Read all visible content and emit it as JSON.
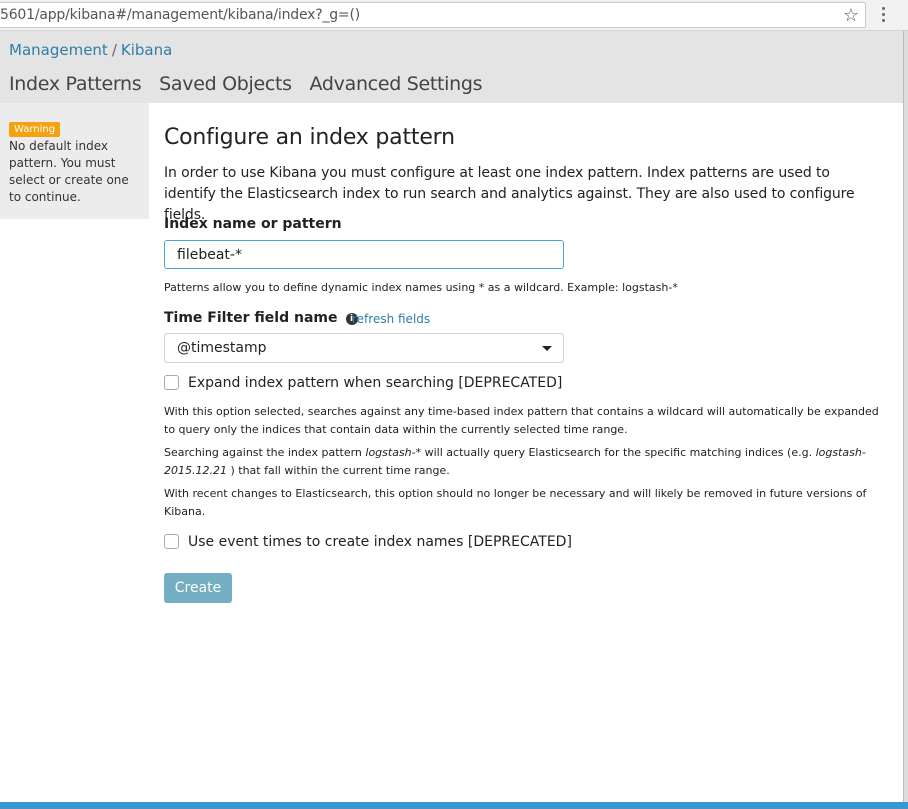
{
  "browser": {
    "url": "5601/app/kibana#/management/kibana/index?_g=()",
    "star_icon": "star-icon",
    "menu_icon": "more-vert-icon"
  },
  "breadcrumb": {
    "management": "Management",
    "separator": "/",
    "kibana": "Kibana"
  },
  "nav": {
    "tabs": [
      "Index Patterns",
      "Saved Objects",
      "Advanced Settings"
    ]
  },
  "sidebar": {
    "badge": "Warning",
    "message": "No default index pattern. You must select or create one to continue."
  },
  "main": {
    "title": "Configure an index pattern",
    "intro": "In order to use Kibana you must configure at least one index pattern. Index patterns are used to identify the Elasticsearch index to run search and analytics against. They are also used to configure fields.",
    "index_label": "Index name or pattern",
    "index_value": "filebeat-*",
    "index_help": "Patterns allow you to define dynamic index names using * as a wildcard. Example: logstash-*",
    "time_label": "Time Filter field name",
    "refresh_link": "refresh fields",
    "time_value": "@timestamp",
    "expand_label": "Expand index pattern when searching [DEPRECATED]",
    "expand_help1": "With this option selected, searches against any time-based index pattern that contains a wildcard will automatically be expanded to query only the indices that contain data within the currently selected time range.",
    "expand_help2_a": "Searching against the index pattern ",
    "expand_help2_pattern": "logstash-*",
    "expand_help2_b": " will actually query Elasticsearch for the specific matching indices (e.g. ",
    "expand_help2_example": "logstash-2015.12.21",
    "expand_help2_c": " ) that fall within the current time range.",
    "expand_help3": "With recent changes to Elasticsearch, this option should no longer be necessary and will likely be removed in future versions of Kibana.",
    "event_label": "Use event times to create index names [DEPRECATED]",
    "create_button": "Create"
  },
  "colors": {
    "link": "#2f7ea8",
    "warning": "#f2a30f",
    "button": "#74aec3",
    "input_focus": "#4ba3d4"
  }
}
